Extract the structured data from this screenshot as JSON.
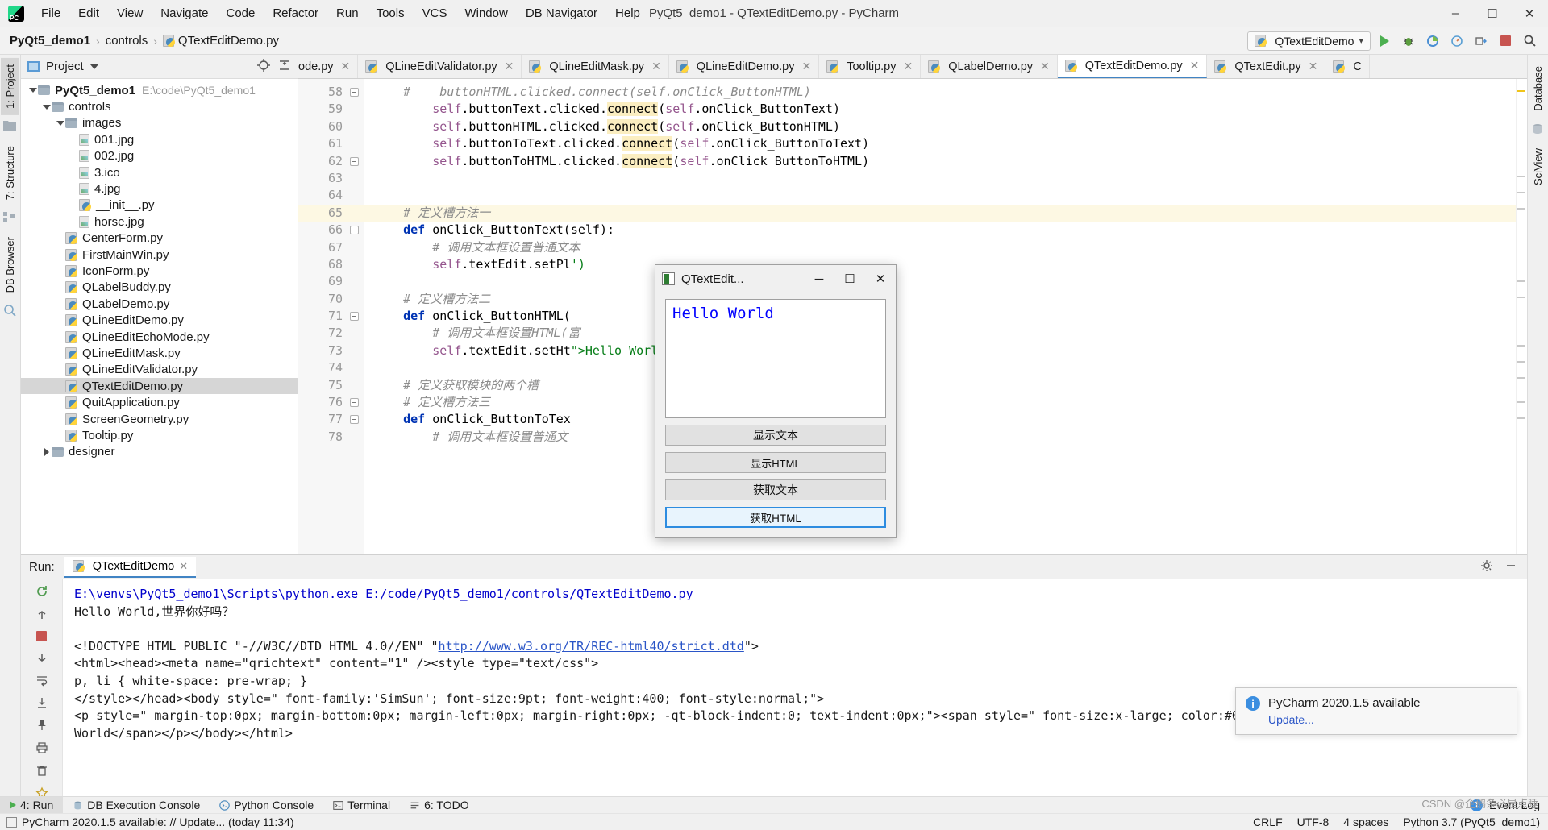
{
  "window": {
    "title": "PyQt5_demo1 - QTextEditDemo.py - PyCharm",
    "logo": "pycharm-logo",
    "minimize": "–",
    "maximize": "☐",
    "close": "✕"
  },
  "menubar": [
    {
      "label": "File"
    },
    {
      "label": "Edit"
    },
    {
      "label": "View"
    },
    {
      "label": "Navigate"
    },
    {
      "label": "Code"
    },
    {
      "label": "Refactor"
    },
    {
      "label": "Run"
    },
    {
      "label": "Tools"
    },
    {
      "label": "VCS"
    },
    {
      "label": "Window"
    },
    {
      "label": "DB Navigator"
    },
    {
      "label": "Help"
    }
  ],
  "breadcrumb": {
    "project": "PyQt5_demo1",
    "folder": "controls",
    "file": "QTextEditDemo.py",
    "separator": "›"
  },
  "toolbar": {
    "run_config": "QTextEditDemo",
    "run_config_caret": "▾",
    "buttons": [
      "run-button",
      "debug-button",
      "coverage-button",
      "profile-button",
      "attach-button",
      "stop-button",
      "search-everywhere-button"
    ]
  },
  "left_strip": {
    "tabs": [
      {
        "label": "1: Project",
        "active": true
      },
      {
        "label": "7: Structure",
        "active": false
      },
      {
        "label": "DB Browser",
        "active": false
      }
    ]
  },
  "right_strip": {
    "tabs": [
      {
        "label": "Database"
      },
      {
        "label": "SciView"
      }
    ]
  },
  "project_panel": {
    "header_title": "Project",
    "tree": [
      {
        "depth": 0,
        "arrow": "down",
        "icon": "folder",
        "label": "PyQt5_demo1",
        "bold": true,
        "path": "E:\\code\\PyQt5_demo1",
        "selected": false
      },
      {
        "depth": 1,
        "arrow": "down",
        "icon": "folder",
        "label": "controls",
        "bold": false,
        "path": "",
        "selected": false
      },
      {
        "depth": 2,
        "arrow": "down",
        "icon": "folder",
        "label": "images",
        "bold": false,
        "path": "",
        "selected": false
      },
      {
        "depth": 3,
        "arrow": "none",
        "icon": "image",
        "label": "001.jpg",
        "bold": false,
        "path": "",
        "selected": false
      },
      {
        "depth": 3,
        "arrow": "none",
        "icon": "image",
        "label": "002.jpg",
        "bold": false,
        "path": "",
        "selected": false
      },
      {
        "depth": 3,
        "arrow": "none",
        "icon": "image",
        "label": "3.ico",
        "bold": false,
        "path": "",
        "selected": false
      },
      {
        "depth": 3,
        "arrow": "none",
        "icon": "image",
        "label": "4.jpg",
        "bold": false,
        "path": "",
        "selected": false
      },
      {
        "depth": 3,
        "arrow": "none",
        "icon": "python",
        "label": "__init__.py",
        "bold": false,
        "path": "",
        "selected": false
      },
      {
        "depth": 3,
        "arrow": "none",
        "icon": "image",
        "label": "horse.jpg",
        "bold": false,
        "path": "",
        "selected": false
      },
      {
        "depth": 2,
        "arrow": "none",
        "icon": "python",
        "label": "CenterForm.py",
        "bold": false,
        "path": "",
        "selected": false
      },
      {
        "depth": 2,
        "arrow": "none",
        "icon": "python",
        "label": "FirstMainWin.py",
        "bold": false,
        "path": "",
        "selected": false
      },
      {
        "depth": 2,
        "arrow": "none",
        "icon": "python",
        "label": "IconForm.py",
        "bold": false,
        "path": "",
        "selected": false
      },
      {
        "depth": 2,
        "arrow": "none",
        "icon": "python",
        "label": "QLabelBuddy.py",
        "bold": false,
        "path": "",
        "selected": false
      },
      {
        "depth": 2,
        "arrow": "none",
        "icon": "python",
        "label": "QLabelDemo.py",
        "bold": false,
        "path": "",
        "selected": false
      },
      {
        "depth": 2,
        "arrow": "none",
        "icon": "python",
        "label": "QLineEditDemo.py",
        "bold": false,
        "path": "",
        "selected": false
      },
      {
        "depth": 2,
        "arrow": "none",
        "icon": "python",
        "label": "QLineEditEchoMode.py",
        "bold": false,
        "path": "",
        "selected": false
      },
      {
        "depth": 2,
        "arrow": "none",
        "icon": "python",
        "label": "QLineEditMask.py",
        "bold": false,
        "path": "",
        "selected": false
      },
      {
        "depth": 2,
        "arrow": "none",
        "icon": "python",
        "label": "QLineEditValidator.py",
        "bold": false,
        "path": "",
        "selected": false
      },
      {
        "depth": 2,
        "arrow": "none",
        "icon": "python",
        "label": "QTextEditDemo.py",
        "bold": false,
        "path": "",
        "selected": true
      },
      {
        "depth": 2,
        "arrow": "none",
        "icon": "python",
        "label": "QuitApplication.py",
        "bold": false,
        "path": "",
        "selected": false
      },
      {
        "depth": 2,
        "arrow": "none",
        "icon": "python",
        "label": "ScreenGeometry.py",
        "bold": false,
        "path": "",
        "selected": false
      },
      {
        "depth": 2,
        "arrow": "none",
        "icon": "python",
        "label": "Tooltip.py",
        "bold": false,
        "path": "",
        "selected": false
      },
      {
        "depth": 1,
        "arrow": "right",
        "icon": "folder",
        "label": "designer",
        "bold": false,
        "path": "",
        "selected": false
      }
    ]
  },
  "editor": {
    "tabs": [
      {
        "label": "ode.py",
        "active": false,
        "clipped": true
      },
      {
        "label": "QLineEditValidator.py",
        "active": false,
        "clipped": false
      },
      {
        "label": "QLineEditMask.py",
        "active": false,
        "clipped": false
      },
      {
        "label": "QLineEditDemo.py",
        "active": false,
        "clipped": false
      },
      {
        "label": "Tooltip.py",
        "active": false,
        "clipped": false
      },
      {
        "label": "QLabelDemo.py",
        "active": false,
        "clipped": false
      },
      {
        "label": "QTextEditDemo.py",
        "active": true,
        "clipped": false
      },
      {
        "label": "QTextEdit.py",
        "active": false,
        "clipped": false
      },
      {
        "label": "C",
        "active": false,
        "clipped": false
      }
    ],
    "close_glyph": "✕",
    "footer_breadcrumb": "QTextEditDemo",
    "lines": [
      {
        "num": "58",
        "current": false,
        "fold": true,
        "segments": [
          {
            "t": "    ",
            "c": ""
          },
          {
            "t": "#    buttonHTML.clicked.connect(self.onClick_ButtonHTML)",
            "c": "cmt"
          }
        ]
      },
      {
        "num": "59",
        "current": false,
        "fold": false,
        "segments": [
          {
            "t": "        ",
            "c": ""
          },
          {
            "t": "self",
            "c": "self"
          },
          {
            "t": ".buttonText.clicked.",
            "c": ""
          },
          {
            "t": "connect",
            "c": "hl"
          },
          {
            "t": "(",
            "c": ""
          },
          {
            "t": "self",
            "c": "self"
          },
          {
            "t": ".onClick_ButtonText)",
            "c": ""
          }
        ]
      },
      {
        "num": "60",
        "current": false,
        "fold": false,
        "segments": [
          {
            "t": "        ",
            "c": ""
          },
          {
            "t": "self",
            "c": "self"
          },
          {
            "t": ".buttonHTML.clicked.",
            "c": ""
          },
          {
            "t": "connect",
            "c": "hl"
          },
          {
            "t": "(",
            "c": ""
          },
          {
            "t": "self",
            "c": "self"
          },
          {
            "t": ".onClick_ButtonHTML)",
            "c": ""
          }
        ]
      },
      {
        "num": "61",
        "current": false,
        "fold": false,
        "segments": [
          {
            "t": "        ",
            "c": ""
          },
          {
            "t": "self",
            "c": "self"
          },
          {
            "t": ".buttonToText.clicked.",
            "c": ""
          },
          {
            "t": "connect",
            "c": "hl"
          },
          {
            "t": "(",
            "c": ""
          },
          {
            "t": "self",
            "c": "self"
          },
          {
            "t": ".onClick_ButtonToText)",
            "c": ""
          }
        ]
      },
      {
        "num": "62",
        "current": false,
        "fold": true,
        "segments": [
          {
            "t": "        ",
            "c": ""
          },
          {
            "t": "self",
            "c": "self"
          },
          {
            "t": ".buttonToHTML.clicked.",
            "c": ""
          },
          {
            "t": "connect",
            "c": "hl"
          },
          {
            "t": "(",
            "c": ""
          },
          {
            "t": "self",
            "c": "self"
          },
          {
            "t": ".onClick_ButtonToHTML)",
            "c": ""
          }
        ]
      },
      {
        "num": "63",
        "current": false,
        "fold": false,
        "segments": []
      },
      {
        "num": "64",
        "current": false,
        "fold": false,
        "segments": []
      },
      {
        "num": "65",
        "current": true,
        "fold": false,
        "segments": [
          {
            "t": "    ",
            "c": ""
          },
          {
            "t": "# 定义槽方法一",
            "c": "cmt"
          }
        ]
      },
      {
        "num": "66",
        "current": false,
        "fold": true,
        "segments": [
          {
            "t": "    ",
            "c": ""
          },
          {
            "t": "def",
            "c": "kw"
          },
          {
            "t": " onClick_ButtonText(self):",
            "c": ""
          }
        ]
      },
      {
        "num": "67",
        "current": false,
        "fold": false,
        "segments": [
          {
            "t": "        ",
            "c": ""
          },
          {
            "t": "# 调用文本框设置普通文本",
            "c": "cmt"
          }
        ]
      },
      {
        "num": "68",
        "current": false,
        "fold": false,
        "segments": [
          {
            "t": "        ",
            "c": ""
          },
          {
            "t": "self",
            "c": "self"
          },
          {
            "t": ".textEdit.setPl",
            "c": ""
          },
          {
            "t": "')",
            "c": "str"
          }
        ]
      },
      {
        "num": "69",
        "current": false,
        "fold": false,
        "segments": []
      },
      {
        "num": "70",
        "current": false,
        "fold": false,
        "segments": [
          {
            "t": "    ",
            "c": ""
          },
          {
            "t": "# 定义槽方法二",
            "c": "cmt"
          }
        ]
      },
      {
        "num": "71",
        "current": false,
        "fold": true,
        "segments": [
          {
            "t": "    ",
            "c": ""
          },
          {
            "t": "def",
            "c": "kw"
          },
          {
            "t": " onClick_ButtonHTML(",
            "c": ""
          }
        ]
      },
      {
        "num": "72",
        "current": false,
        "fold": false,
        "segments": [
          {
            "t": "        ",
            "c": ""
          },
          {
            "t": "# 调用文本框设置HTML(富",
            "c": "cmt"
          }
        ]
      },
      {
        "num": "73",
        "current": false,
        "fold": false,
        "segments": [
          {
            "t": "        ",
            "c": ""
          },
          {
            "t": "self",
            "c": "self"
          },
          {
            "t": ".textEdit.setHt",
            "c": ""
          },
          {
            "t": "\">Hello World</font>')",
            "c": "str"
          }
        ]
      },
      {
        "num": "74",
        "current": false,
        "fold": false,
        "segments": []
      },
      {
        "num": "75",
        "current": false,
        "fold": false,
        "segments": [
          {
            "t": "    ",
            "c": ""
          },
          {
            "t": "# 定义获取模块的两个槽",
            "c": "cmt"
          }
        ]
      },
      {
        "num": "76",
        "current": false,
        "fold": true,
        "segments": [
          {
            "t": "    ",
            "c": ""
          },
          {
            "t": "# 定义槽方法三",
            "c": "cmt"
          }
        ]
      },
      {
        "num": "77",
        "current": false,
        "fold": true,
        "segments": [
          {
            "t": "    ",
            "c": ""
          },
          {
            "t": "def",
            "c": "kw"
          },
          {
            "t": " onClick_ButtonToTex",
            "c": ""
          }
        ]
      },
      {
        "num": "78",
        "current": false,
        "fold": false,
        "segments": [
          {
            "t": "        ",
            "c": ""
          },
          {
            "t": "# 调用文本框设置普通文",
            "c": "cmt"
          }
        ]
      }
    ]
  },
  "qt_dialog": {
    "title": "QTextEdit...",
    "minimize": "─",
    "maximize": "☐",
    "close": "✕",
    "textedit_value": "Hello World",
    "textedit_color": "#0000ff",
    "buttons": [
      {
        "label": "显示文本",
        "focused": false,
        "small": false
      },
      {
        "label": "显示HTML",
        "focused": false,
        "small": true
      },
      {
        "label": "获取文本",
        "focused": false,
        "small": false
      },
      {
        "label": "获取HTML",
        "focused": true,
        "small": true
      }
    ]
  },
  "run_panel": {
    "label": "Run:",
    "tab_label": "QTextEditDemo",
    "close_glyph": "✕",
    "console_lines": [
      {
        "text": "E:\\venvs\\PyQt5_demo1\\Scripts\\python.exe E:/code/PyQt5_demo1/controls/QTextEditDemo.py",
        "style": "blue"
      },
      {
        "text": "Hello World,世界你好吗？",
        "style": "plain"
      },
      {
        "text": "",
        "style": "plain"
      },
      {
        "text": "<!DOCTYPE HTML PUBLIC \"-//W3C//DTD HTML 4.0//EN\" \"http://www.w3.org/TR/REC-html40/strict.dtd\">",
        "style": "plain-with-link"
      },
      {
        "text": "<html><head><meta name=\"qrichtext\" content=\"1\" /><style type=\"text/css\">",
        "style": "plain"
      },
      {
        "text": "p, li { white-space: pre-wrap; }",
        "style": "plain"
      },
      {
        "text": "</style></head><body style=\" font-family:'SimSun'; font-size:9pt; font-weight:400; font-style:normal;\">",
        "style": "plain"
      },
      {
        "text": "<p style=\" margin-top:0px; margin-bottom:0px; margin-left:0px; margin-right:0px; -qt-block-indent:0; text-indent:0px;\"><span style=\" font-size:x-large; color:#0000ff;\">Hello",
        "style": "plain"
      },
      {
        "text": " World</span></p></body></html>",
        "style": "plain"
      }
    ],
    "link_text": "http://www.w3.org/TR/REC-html40/strict.dtd",
    "sidebar_icons": [
      "rerun-icon",
      "scroll-up-icon",
      "stop-icon",
      "scroll-down-icon",
      "print-layout-icon",
      "soft-wrap-icon",
      "scroll-to-end-icon",
      "pin-icon",
      "print-icon",
      "trash-icon",
      "favorites-star-icon"
    ]
  },
  "notification": {
    "icon": "info-icon",
    "title": "PyCharm 2020.1.5 available",
    "link": "Update..."
  },
  "bottom_bar": {
    "items": [
      {
        "label": "4: Run",
        "icon": "run-icon",
        "active": true
      },
      {
        "label": "DB Execution Console",
        "icon": "db-icon",
        "active": false
      },
      {
        "label": "Python Console",
        "icon": "python-console-icon",
        "active": false
      },
      {
        "label": "Terminal",
        "icon": "terminal-icon",
        "active": false
      },
      {
        "label": "6: TODO",
        "icon": "todo-icon",
        "active": false
      }
    ],
    "event_log": "Event Log",
    "event_log_badge": "1"
  },
  "status_bar": {
    "message": "PyCharm 2020.1.5 available: // Update... (today 11:34)",
    "line_sep": "CRLF",
    "encoding": "UTF-8",
    "indent": "4 spaces",
    "interpreter": "Python 3.7 (PyQt5_demo1)"
  },
  "watermark": "CSDN @企鹅条必是点睡",
  "colors": {
    "accent": "#4184c4",
    "keyword": "#0033b3",
    "comment": "#8c8c8c",
    "string": "#067d17",
    "self": "#94558d",
    "link": "#2a55c7",
    "dialog_text": "#0000ff",
    "run_green": "#4caf50",
    "stop_red": "#c75450"
  }
}
